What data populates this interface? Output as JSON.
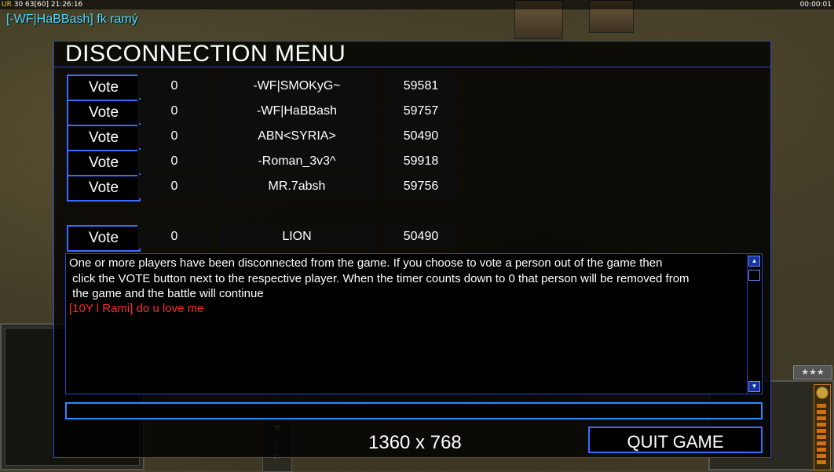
{
  "status_bar": {
    "rank": "UR",
    "stats": "30 63[60]",
    "clock": "21:26:16",
    "timer": "00:00:01"
  },
  "chat_header": "[-WF|HaBBash] fk ramý",
  "dialog": {
    "title": "DISCONNECTION MENU",
    "vote_label": "Vote",
    "players": [
      {
        "votes": "0",
        "name": "-WF|SMOKyG~",
        "ping": "59581"
      },
      {
        "votes": "0",
        "name": "-WF|HaBBash",
        "ping": "59757"
      },
      {
        "votes": "0",
        "name": "ABN<SYRIA>",
        "ping": "50490"
      },
      {
        "votes": "0",
        "name": "-Roman_3v3^",
        "ping": "59918"
      },
      {
        "votes": "0",
        "name": "MR.7absh",
        "ping": "59756"
      },
      {
        "votes": "0",
        "name": "LION",
        "ping": "50490"
      }
    ],
    "message": "One or more players have been disconnected from the game. If you choose to vote a person out of the game then\n click the VOTE button next to the respective player. When the timer counts down to 0 that person will be removed from\n the game and the battle will continue",
    "chat_line": "[10Y l Rami] do u love me",
    "chat_input_value": "",
    "resolution": "1360 x 768",
    "quit_label": "QUIT GAME"
  },
  "hud": {
    "rank_stars": "★★★"
  },
  "colors": {
    "dialog_border": "#2a44c8",
    "button_border": "#3a6cff",
    "chat_red": "#ff2a2a",
    "header_cyan": "#4fd8ff"
  }
}
